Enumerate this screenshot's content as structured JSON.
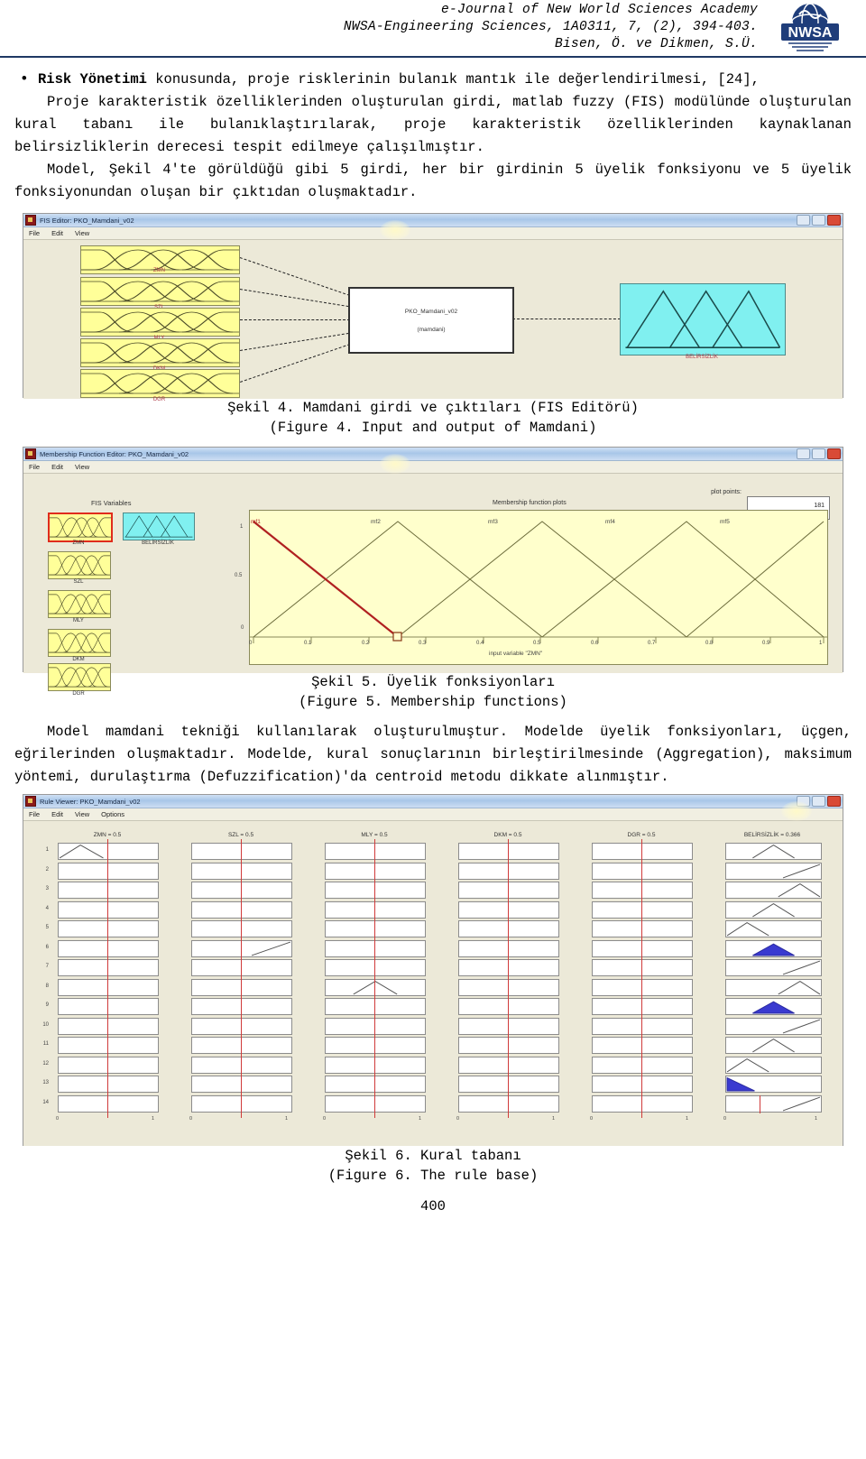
{
  "header": {
    "line1": "e-Journal of New World Sciences Academy",
    "line2": "NWSA-Engineering Sciences, 1A0311, 7, (2), 394-403.",
    "line3": "Bisen, Ö. ve Dikmen, S.Ü.",
    "logo_text": "NWSA",
    "rule_color": "#1f3864"
  },
  "body": {
    "bullet_marker": "•",
    "bullet_bold": "Risk Yönetimi",
    "bullet_rest": " konusunda, proje risklerinin bulanık mantık ile değerlendirilmesi, [24],",
    "para1": "Proje karakteristik özelliklerinden oluşturulan girdi, matlab fuzzy (FIS) modülünde oluşturulan kural tabanı ile bulanıklaştırılarak, proje karakteristik özelliklerinden kaynaklanan belirsizliklerin derecesi tespit edilmeye çalışılmıştır.",
    "para2": "Model, Şekil 4'te görüldüğü gibi 5 girdi, her bir girdinin 5 üyelik fonksiyonu ve 5 üyelik fonksiyonundan oluşan bir çıktıdan oluşmaktadır.",
    "para3": "Model mamdani tekniği kullanılarak oluşturulmuştur. Modelde üyelik fonksiyonları, üçgen, eğrilerinden oluşmaktadır. Modelde, kural sonuçlarının birleştirilmesinde (Aggregation), maksimum yöntemi, durulaştırma (Defuzzification)'da centroid metodu dikkate alınmıştır."
  },
  "figure4": {
    "window_title": "FIS Editor: PKO_Mamdani_v02",
    "menus": [
      "File",
      "Edit",
      "View"
    ],
    "input_labels": [
      "ZMN",
      "SZL",
      "MLY",
      "DKM",
      "DGR"
    ],
    "system_name": "PKO_Mamdani_v02",
    "system_type": "(mamdani)",
    "output_label": "BELİRSİZLİK",
    "caption_tr": "Şekil 4. Mamdani girdi ve çıktıları (FIS Editörü)",
    "caption_en": "(Figure 4. Input and output of Mamdani)"
  },
  "figure5": {
    "window_title": "Membership Function Editor: PKO_Mamdani_v02",
    "menus": [
      "File",
      "Edit",
      "View"
    ],
    "fis_variables_label": "FIS Variables",
    "input_labels": [
      "ZMN",
      "SZL",
      "MLY",
      "DKM",
      "DGR"
    ],
    "output_label": "BELİRSİZLİK",
    "plots_title": "Membership function plots",
    "plot_points_label": "plot points:",
    "plot_points_value": "181",
    "mf_names": [
      "mf1",
      "mf2",
      "mf3",
      "mf4",
      "mf5"
    ],
    "y_ticks": [
      "1",
      "0.5",
      "0"
    ],
    "x_ticks": [
      "0",
      "0.1",
      "0.2",
      "0.3",
      "0.4",
      "0.5",
      "0.6",
      "0.7",
      "0.8",
      "0.9",
      "1"
    ],
    "x_axis_label": "input variable \"ZMN\"",
    "selected_variable": "ZMN",
    "caption_tr": "Şekil 5. Üyelik fonksiyonları",
    "caption_en": "(Figure 5. Membership functions)"
  },
  "figure6": {
    "window_title": "Rule Viewer: PKO_Mamdani_v02",
    "menus": [
      "File",
      "Edit",
      "View",
      "Options"
    ],
    "column_headers": [
      "ZMN = 0.5",
      "SZL = 0.5",
      "MLY = 0.5",
      "DKM = 0.5",
      "DGR = 0.5",
      "BELİRSİZLİK = 0.366"
    ],
    "rule_numbers": [
      "1",
      "2",
      "3",
      "4",
      "5",
      "6",
      "7",
      "8",
      "9",
      "10",
      "11",
      "12",
      "13",
      "14"
    ],
    "axis_min": "0",
    "axis_max": "1",
    "caption_tr": "Şekil 6. Kural tabanı",
    "caption_en": "(Figure 6. The rule base)"
  },
  "footer": {
    "page_number": "400"
  },
  "chart_data": {
    "type": "line",
    "title": "Membership function plots",
    "xlabel": "input variable \"ZMN\"",
    "ylabel": "",
    "xlim": [
      0,
      1
    ],
    "ylim": [
      0,
      1
    ],
    "series": [
      {
        "name": "mf1",
        "x": [
          0,
          0.25
        ],
        "y": [
          1,
          0
        ],
        "color": "#b02020",
        "selected": true
      },
      {
        "name": "mf2",
        "x": [
          0,
          0.25,
          0.5
        ],
        "y": [
          0,
          1,
          0
        ],
        "color": "#6b6b3a"
      },
      {
        "name": "mf3",
        "x": [
          0.25,
          0.5,
          0.75
        ],
        "y": [
          0,
          1,
          0
        ],
        "color": "#6b6b3a"
      },
      {
        "name": "mf4",
        "x": [
          0.5,
          0.75,
          1.0
        ],
        "y": [
          0,
          1,
          0
        ],
        "color": "#6b6b3a"
      },
      {
        "name": "mf5",
        "x": [
          0.75,
          1.0
        ],
        "y": [
          0,
          1
        ],
        "color": "#6b6b3a"
      }
    ],
    "selected_point": {
      "x": 0.25,
      "y": 0
    }
  }
}
